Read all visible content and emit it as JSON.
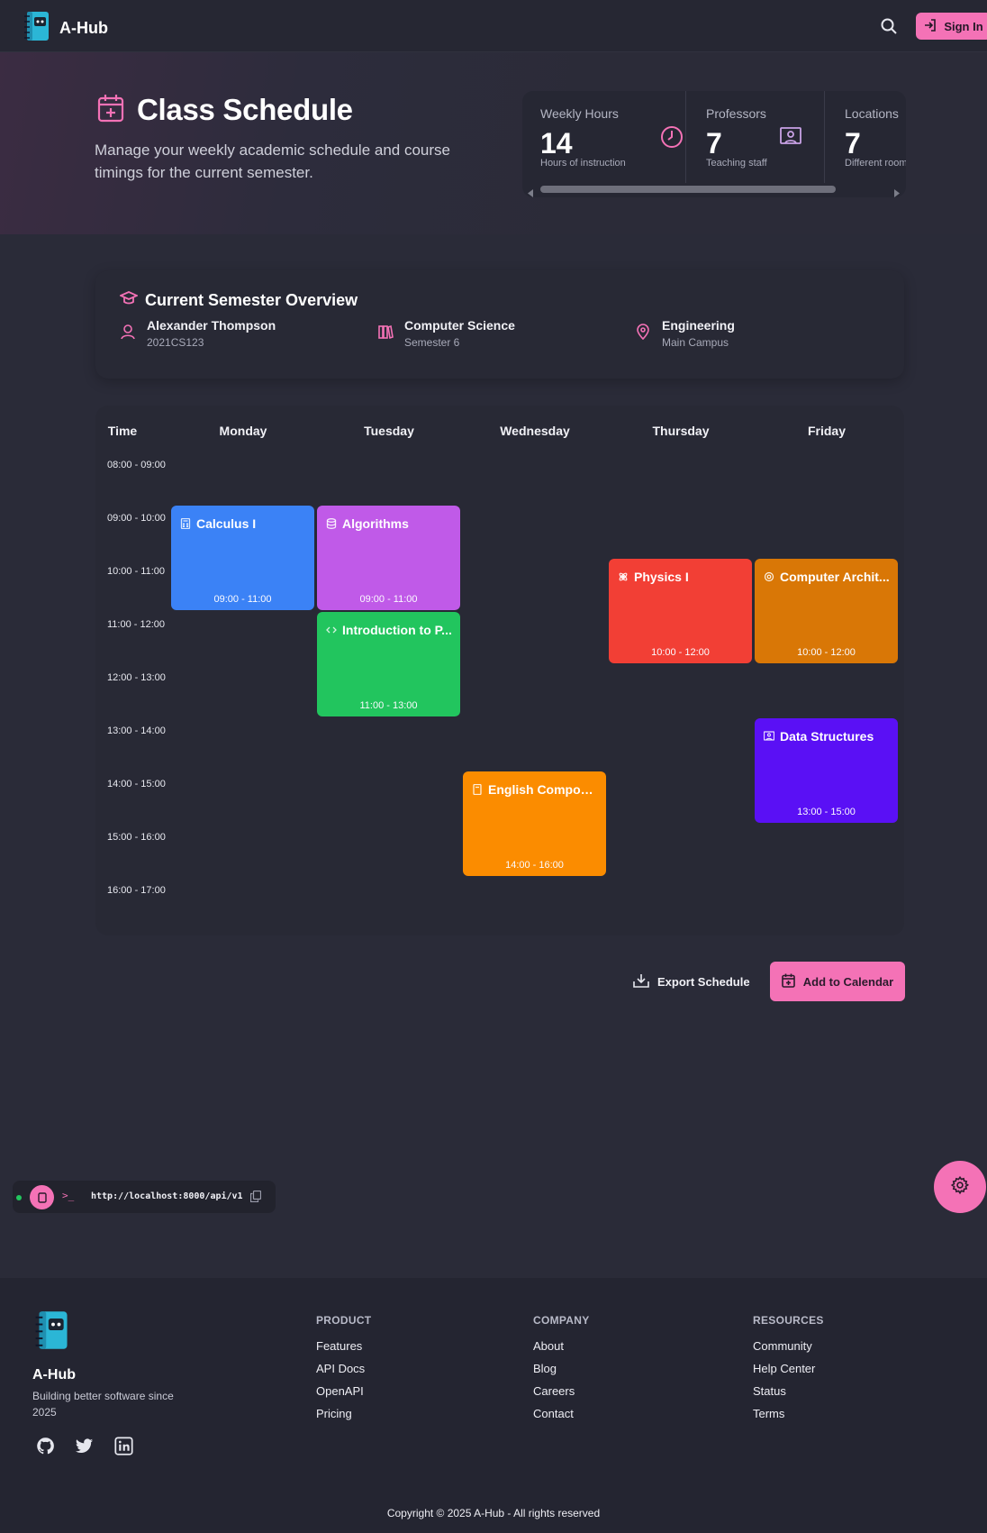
{
  "app": {
    "name": "A-Hub"
  },
  "nav": {
    "signin_label": "Sign In"
  },
  "hero": {
    "title": "Class Schedule",
    "subtitle": "Manage your weekly academic schedule and course timings for the current semester."
  },
  "stats": [
    {
      "label": "Weekly Hours",
      "value": "14",
      "desc": "Hours of instruction",
      "icon": "clock-icon"
    },
    {
      "label": "Professors",
      "value": "7",
      "desc": "Teaching staff",
      "icon": "presentation-icon"
    },
    {
      "label": "Locations",
      "value": "7",
      "desc": "Different rooms",
      "icon": "map-pin-icon"
    }
  ],
  "overview": {
    "title": "Current Semester Overview",
    "student": {
      "name": "Alexander Thompson",
      "id": "2021CS123"
    },
    "program": {
      "name": "Computer Science",
      "semester": "Semester 6"
    },
    "campus": {
      "department": "Engineering",
      "location": "Main Campus"
    }
  },
  "schedule": {
    "time_header": "Time",
    "days": [
      "Monday",
      "Tuesday",
      "Wednesday",
      "Thursday",
      "Friday"
    ],
    "slots": [
      "08:00 - 09:00",
      "09:00 - 10:00",
      "10:00 - 11:00",
      "11:00 - 12:00",
      "12:00 - 13:00",
      "13:00 - 14:00",
      "14:00 - 15:00",
      "15:00 - 16:00",
      "16:00 - 17:00"
    ],
    "courses": [
      {
        "title": "Calculus I",
        "time": "09:00 - 11:00",
        "day": "Monday",
        "color": "#3b82f6",
        "icon": "calculator-icon"
      },
      {
        "title": "Algorithms",
        "time": "09:00 - 11:00",
        "day": "Tuesday",
        "color": "#c05ae8",
        "icon": "database-icon"
      },
      {
        "title": "Introduction to P...",
        "time": "11:00 - 13:00",
        "day": "Tuesday",
        "color": "#22c55e",
        "icon": "code-icon"
      },
      {
        "title": "English Composi...",
        "time": "14:00 - 16:00",
        "day": "Wednesday",
        "color": "#fb8c00",
        "icon": "book-icon"
      },
      {
        "title": "Physics I",
        "time": "10:00 - 12:00",
        "day": "Thursday",
        "color": "#f23f35",
        "icon": "atom-icon"
      },
      {
        "title": "Computer Archit...",
        "time": "10:00 - 12:00",
        "day": "Friday",
        "color": "#d97706",
        "icon": "cpu-icon"
      },
      {
        "title": "Data Structures",
        "time": "13:00 - 15:00",
        "day": "Friday",
        "color": "#5a10f5",
        "icon": "presentation-icon"
      }
    ]
  },
  "actions": {
    "export_label": "Export Schedule",
    "add_calendar_label": "Add to Calendar"
  },
  "api": {
    "prompt": ">_",
    "url": "http://localhost:8000/api/v1"
  },
  "footer": {
    "name": "A-Hub",
    "tagline": "Building better software since 2025",
    "columns": [
      {
        "heading": "PRODUCT",
        "links": [
          "Features",
          "API Docs",
          "OpenAPI",
          "Pricing"
        ]
      },
      {
        "heading": "COMPANY",
        "links": [
          "About",
          "Blog",
          "Careers",
          "Contact"
        ]
      },
      {
        "heading": "RESOURCES",
        "links": [
          "Community",
          "Help Center",
          "Status",
          "Terms"
        ]
      }
    ],
    "copyright": "Copyright © 2025 A-Hub - All rights reserved"
  }
}
